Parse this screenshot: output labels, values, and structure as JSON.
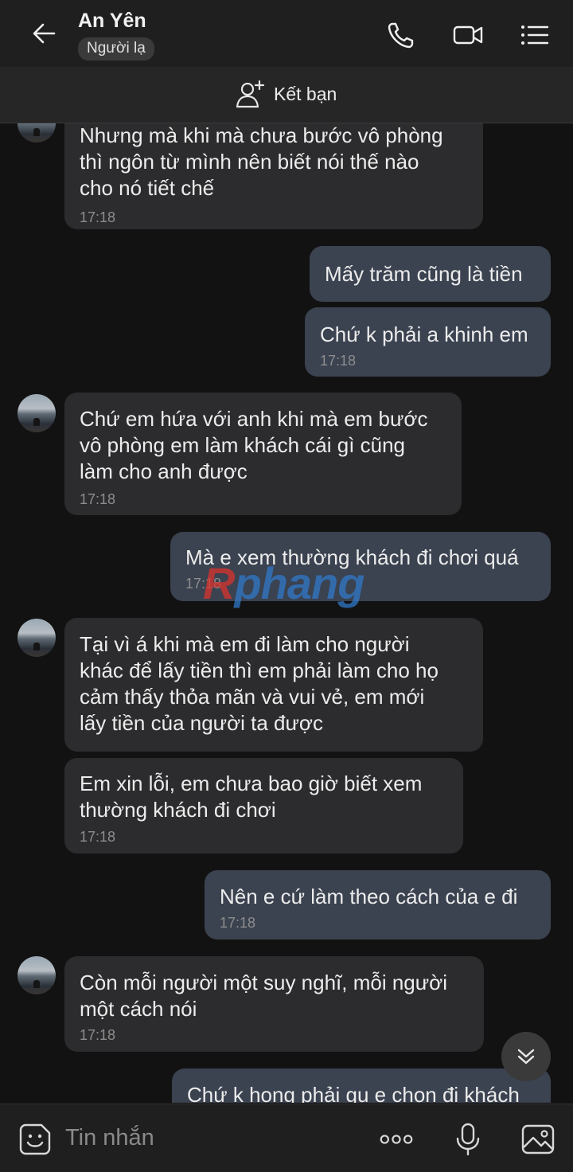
{
  "header": {
    "contact_name": "An Yên",
    "stranger_badge": "Người lạ",
    "icons": [
      "back-arrow-icon",
      "phone-icon",
      "video-call-icon",
      "menu-list-icon"
    ]
  },
  "friend_bar": {
    "label": "Kết bạn",
    "icon": "add-friend-icon"
  },
  "messages": [
    {
      "dir": "in",
      "text": "Nhưng mà khi mà chưa bước vô phòng\nthì ngôn từ mình nên biết nói thế nào\ncho nó tiết chế",
      "time": "17:18"
    },
    {
      "dir": "out",
      "text": "Mấy trăm cũng là tiền",
      "time": ""
    },
    {
      "dir": "out",
      "text": "Chứ k phải a khinh em",
      "time": "17:18"
    },
    {
      "dir": "in",
      "text": "Chứ em hứa với anh khi mà em bước\nvô phòng em làm khách cái gì cũng\nlàm cho anh được",
      "time": "17:18"
    },
    {
      "dir": "out",
      "text": "Mà e xem thường khách đi chơi quá",
      "time": "17:18"
    },
    {
      "dir": "in",
      "text": "Tại vì á khi mà em đi làm cho người\nkhác để lấy tiền thì em phải làm cho họ\ncảm thấy thỏa mãn và vui vẻ, em mới\nlấy tiền của người ta được",
      "time": ""
    },
    {
      "dir": "in",
      "text": "Em xin lỗi, em chưa bao giờ biết xem\nthường khách đi chơi",
      "time": "17:18"
    },
    {
      "dir": "out",
      "text": "Nên e cứ làm theo cách của e đi",
      "time": "17:18"
    },
    {
      "dir": "in",
      "text": "Còn mỗi người một suy nghĩ, mỗi người\nmột cách nói",
      "time": "17:18"
    },
    {
      "dir": "out",
      "text": "Chứ k hong phải gu e chọn đi khách",
      "time": ""
    }
  ],
  "watermark": {
    "first": "R",
    "rest": "phang"
  },
  "composer": {
    "placeholder": "Tin nhắn",
    "icons": [
      "emoji-sticker-icon",
      "more-options-icon",
      "microphone-icon",
      "image-gallery-icon"
    ]
  },
  "colors": {
    "background": "#121212",
    "incoming_bubble": "#2c2c2e",
    "outgoing_bubble": "#3b4250",
    "time_text": "#8d8d8d"
  }
}
